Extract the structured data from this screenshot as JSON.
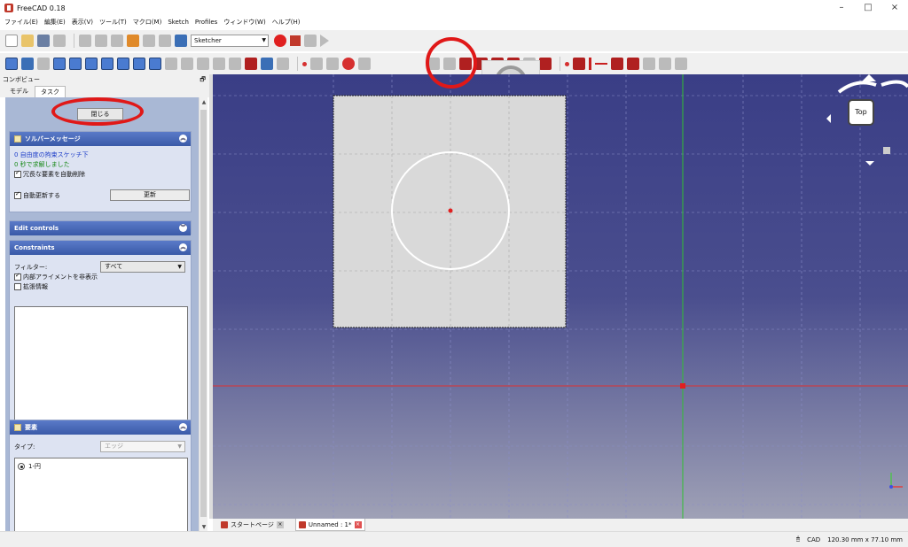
{
  "window": {
    "title": "FreeCAD 0.18",
    "minimize": "–",
    "maximize": "□",
    "close": "×"
  },
  "menu": [
    "ファイル(E)",
    "編集(E)",
    "表示(V)",
    "ツール(T)",
    "マクロ(M)",
    "Sketch",
    "Profiles",
    "ウィンドウ(W)",
    "ヘルプ(H)"
  ],
  "toolbar": {
    "workbench": "Sketcher"
  },
  "combo_view": {
    "title": "コンボビュー",
    "tabs": [
      "モデル",
      "タスク"
    ],
    "active_tab": "タスク",
    "close_button": "閉じる",
    "solver": {
      "title": "ソルバーメッセージ",
      "line1": "0 自由度の拘束スケッチ下",
      "line2": "0 秒で求解しました",
      "auto_remove": "冗長な要素を自動削除",
      "auto_update": "自動更新する",
      "update_button": "更新"
    },
    "edit_controls": {
      "title": "Edit controls"
    },
    "constraints": {
      "title": "Constraints",
      "filter_label": "フィルター:",
      "filter_value": "すべて",
      "hide_internal": "内部アライメントを非表示",
      "extended_info": "拡張情報"
    },
    "elements": {
      "title": "要素",
      "type_label": "タイプ:",
      "type_value": "エッジ",
      "items": [
        "1-円"
      ]
    }
  },
  "navcube": {
    "face": "Top"
  },
  "doc_tabs": [
    {
      "label": "スタートページ",
      "active": false
    },
    {
      "label": "Unnamed : 1*",
      "active": true
    }
  ],
  "status": {
    "nav_style": "CAD",
    "dimensions": "120.30 mm x 77.10 mm"
  },
  "colors": {
    "highlight": "#e01818",
    "sketch_sheet": "#d9d9d9",
    "x_axis": "#e03030",
    "y_axis": "#30c030",
    "circle": "#ffffff"
  }
}
